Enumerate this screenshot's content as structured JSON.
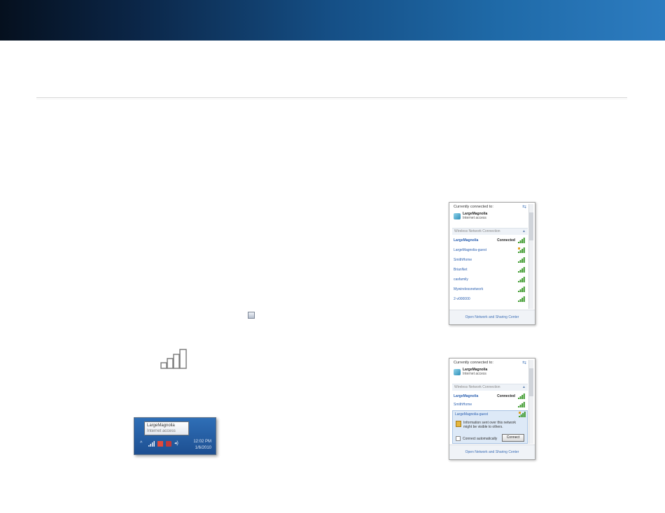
{
  "tooltip": {
    "name": "LargeMagnolia",
    "status": "Internet access"
  },
  "taskbar": {
    "time": "12:02 PM",
    "date": "1/6/2010"
  },
  "panel1": {
    "header": "Currently connected to:",
    "current": {
      "name": "LargeMagnolia",
      "status": "Internet access"
    },
    "section": "Wireless Network Connection",
    "networks": [
      {
        "name": "LargeMagnolia",
        "status": "Connected",
        "bold": true
      },
      {
        "name": "LargeMagnolia-guest",
        "status": "",
        "bold": false
      },
      {
        "name": "SmithHome",
        "status": "",
        "bold": false
      },
      {
        "name": "BrianNet",
        "status": "",
        "bold": false
      },
      {
        "name": "casfamily",
        "status": "",
        "bold": false
      },
      {
        "name": "Mywirelessnetwork",
        "status": "",
        "bold": false
      },
      {
        "name": "2-v000000",
        "status": "",
        "bold": false
      }
    ],
    "footer": "Open Network and Sharing Center"
  },
  "panel2": {
    "header": "Currently connected to:",
    "current": {
      "name": "LargeMagnolia",
      "status": "Internet access"
    },
    "section": "Wireless Network Connection",
    "networks": [
      {
        "name": "LargeMagnolia",
        "status": "Connected",
        "bold": true
      },
      {
        "name": "SmithHome",
        "status": "",
        "bold": false
      }
    ],
    "selected": {
      "name": "LargeMagnolia-guest",
      "warning": "Information sent over this network might be visible to others.",
      "auto_label": "Connect automatically",
      "connect_label": "Connect"
    },
    "footer": "Open Network and Sharing Center"
  },
  "icons": {
    "signal": "signal-bars-icon",
    "refresh": "refresh-icon",
    "network": "network-icon",
    "warning": "warning-shield-icon"
  },
  "colors": {
    "banner_dark": "#05101e",
    "banner_light": "#2d7cc0",
    "link": "#2a5fb0",
    "signal_green": "#3f9b2f"
  }
}
